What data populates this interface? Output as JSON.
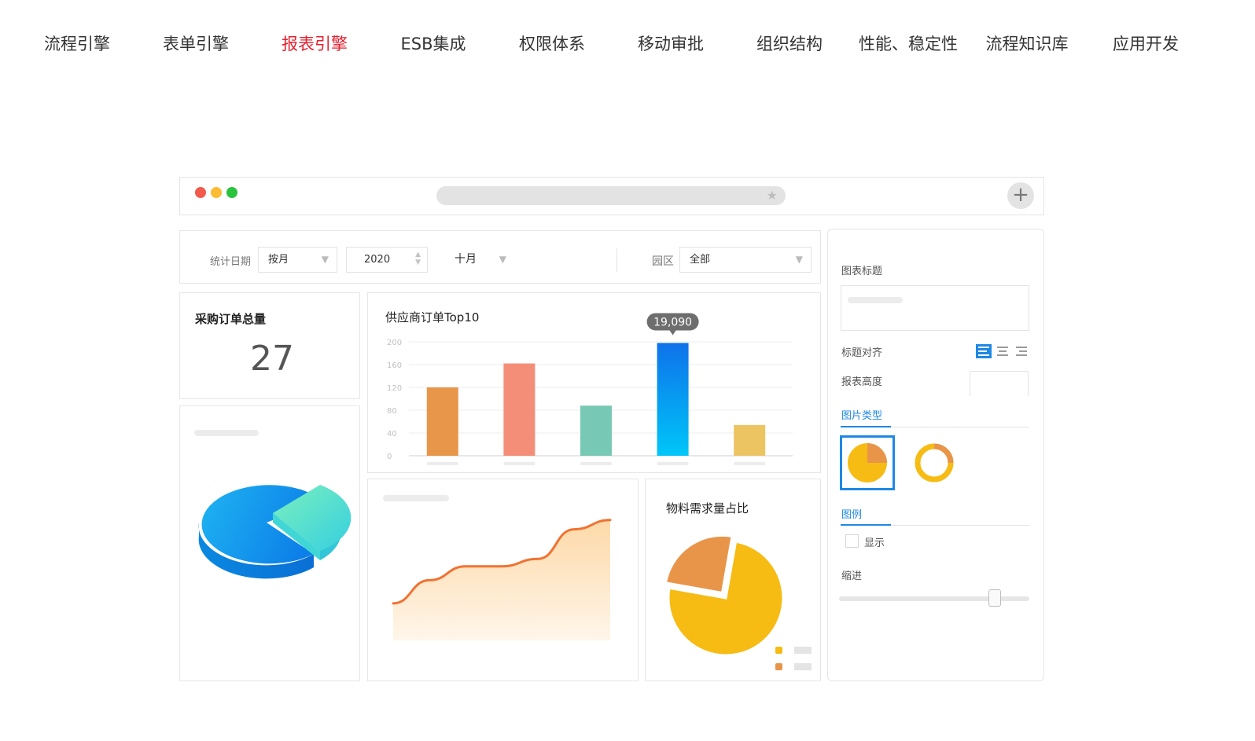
{
  "nav": {
    "items": [
      {
        "label": "流程引擎",
        "active": false
      },
      {
        "label": "表单引擎",
        "active": false
      },
      {
        "label": "报表引擎",
        "active": true
      },
      {
        "label": "ESB集成",
        "active": false
      },
      {
        "label": "权限体系",
        "active": false
      },
      {
        "label": "移动审批",
        "active": false
      },
      {
        "label": "组织结构",
        "active": false
      },
      {
        "label": "性能、稳定性",
        "active": false
      },
      {
        "label": "流程知识库",
        "active": false
      },
      {
        "label": "应用开发",
        "active": false
      }
    ],
    "active_color": "#e5202e"
  },
  "browser": {
    "dots": [
      "#f25a4c",
      "#fbbb33",
      "#2bc33e"
    ],
    "plus_label": "+",
    "star_icon": "star-icon"
  },
  "filter": {
    "date_label": "统计日期",
    "period_value": "按月",
    "year_value": "2020",
    "month_value": "十月",
    "region_label": "园区",
    "region_value": "全部"
  },
  "kpi": {
    "title": "采购订单总量",
    "value": "27"
  },
  "chart_data": [
    {
      "type": "bar",
      "title": "供应商订单Top10",
      "categories": [
        "",
        "",
        "",
        "",
        ""
      ],
      "values": [
        120,
        162,
        88,
        198,
        54
      ],
      "colors": [
        "#e8964a",
        "#f48e78",
        "#78c8b6",
        "#0e85ef",
        "#ecc461"
      ],
      "ylim": [
        0,
        200
      ],
      "yticks": [
        "200",
        "160",
        "120",
        "80",
        "40",
        "0"
      ],
      "tooltip": "19,090",
      "tooltip_index": 3,
      "grid": true
    },
    {
      "type": "area",
      "x": [
        0,
        1,
        2,
        3,
        4,
        5,
        6
      ],
      "values": [
        40,
        65,
        80,
        80,
        88,
        120,
        130
      ],
      "ylim": [
        0,
        140
      ],
      "color": "#f07232"
    },
    {
      "type": "pie",
      "title": "物料需求量占比",
      "values": [
        75,
        25
      ],
      "colors": [
        "#f6bc14",
        "#e8954a"
      ]
    }
  ],
  "pie3d": {
    "colors": [
      "#1ca6ef",
      "#6fe8c3"
    ]
  },
  "settings": {
    "chart_title_label": "图表标题",
    "title_align_label": "标题对齐",
    "report_height_label": "报表高度",
    "image_type_tab": "图片类型",
    "legend_tab": "图例",
    "show_label": "显示",
    "show_checked": false,
    "indent_label": "缩进",
    "indent_level": 0.85
  }
}
